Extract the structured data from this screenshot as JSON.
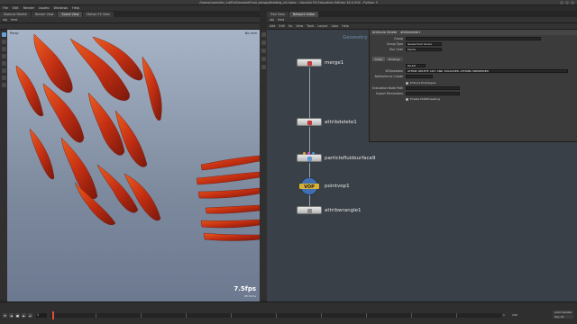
{
  "window": {
    "title": "/home/user/dev_lut/RnD/smokeFluid_setups/feeding_ch.hipnc - Houdini FX Education Edition 16.0.504 - Python 3"
  },
  "menubar": [
    "File",
    "Edit",
    "Render",
    "Assets",
    "Windows",
    "Help"
  ],
  "left_tabs": [
    "Material Palette",
    "Render View",
    "Scene View",
    "Motion FX View"
  ],
  "left_toolbar": [
    "obj",
    "feed"
  ],
  "right_tabs": [
    "Tree View",
    "Network Editor"
  ],
  "network_toolbar": [
    "Add",
    "Edit",
    "Go",
    "View",
    "Tools",
    "Layout",
    "Labs",
    "Help"
  ],
  "viewport": {
    "label": "Persp",
    "camera": "No cam",
    "fps": "7.5fps",
    "fps_sub": "98.52ms"
  },
  "network": {
    "context_label": "Geometry",
    "nodes": [
      {
        "name": "merge1",
        "color": "#c2393b"
      },
      {
        "name": "attribdelete1",
        "color": "#c2393b"
      },
      {
        "name": "particlefluidsurface9",
        "color": "#5a9bd5"
      },
      {
        "name": "pointvop1",
        "color": "#e0b33a"
      },
      {
        "name": "attribwrangle1",
        "color": "#9a9a9a"
      }
    ]
  },
  "params": {
    "node_type": "Attribute Delete",
    "node_name": "attribdelete1",
    "rows": [
      {
        "label": "Group",
        "value": ""
      },
      {
        "label": "Group Type",
        "value": "Guess from Group"
      },
      {
        "label": "Run Over",
        "value": "Points"
      }
    ],
    "tabs": [
      "Code",
      "Bindings"
    ],
    "vex_precision": "64-bit",
    "vex_label": "VEXpression",
    "vex_code": "ATTRIB_DELETE_LIST_AND_EXCLUDED_ATTRIBS_PRESERVED",
    "attribute_to_create": "Attributes to Create",
    "enforce_prototypes": "Enforce Prototypes",
    "include_path": "Evaluation Node Path",
    "export_parameters": "Export Parameters",
    "enable_multithreading": "Enable Multithreading"
  },
  "timeline": {
    "frame": "1",
    "start": "1",
    "end": "240",
    "right_controls": [
      "Auto Update",
      "Key All"
    ]
  }
}
